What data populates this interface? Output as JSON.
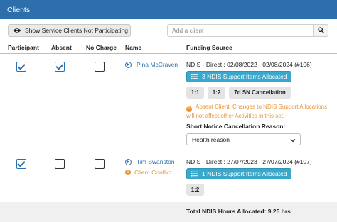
{
  "header": {
    "title": "Clients"
  },
  "toolbar": {
    "show_button_label": "Show Service Clients Not Participating",
    "search_placeholder": "Add a client"
  },
  "columns": {
    "participant": "Participant",
    "absent": "Absent",
    "no_charge": "No Charge",
    "name": "Name",
    "funding_source": "Funding Source"
  },
  "rows": [
    {
      "participant": true,
      "absent": true,
      "no_charge": false,
      "name": "Pina McCraven",
      "funding": "NDIS - Direct : 02/08/2022 - 02/08/2024 (#106)",
      "items_button": "3 NDIS Support Items Allocated",
      "ratio_tags": [
        "1:1",
        "1:2",
        "7d SN Cancellation"
      ],
      "absent_note": "Absent Client: Changes to NDIS Support Allocations will not affect other Activities in this set.",
      "snc_label": "Short Notice Cancellation Reason:",
      "snc_value": "Health reason"
    },
    {
      "participant": true,
      "absent": false,
      "no_charge": false,
      "name": "Tim Swanston",
      "conflict": "Client Conflict",
      "funding": "NDIS - Direct : 27/07/2023 - 27/07/2024 (#107)",
      "items_button": "1 NDIS Support Items Allocated",
      "ratio_tags": [
        "1:2"
      ]
    }
  ],
  "footer": {
    "total": "Total NDIS Hours Allocated: 9.25 hrs"
  },
  "colors": {
    "header": "#2d6fad",
    "link": "#2d6fad",
    "button": "#3aa7cc",
    "warning": "#e8963a"
  }
}
